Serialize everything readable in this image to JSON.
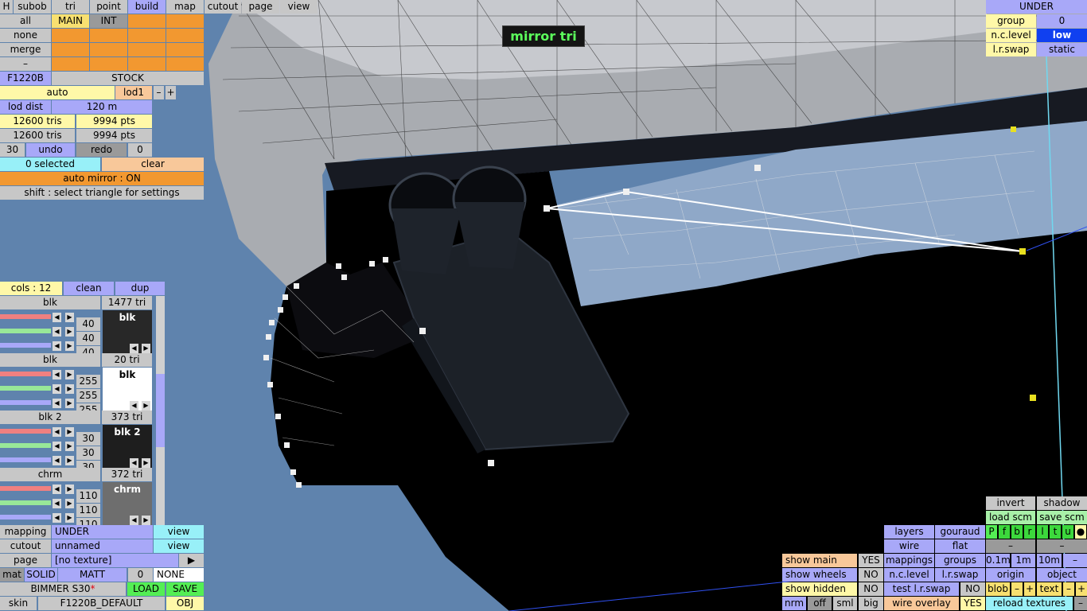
{
  "toast": "mirror tri",
  "menu": {
    "h": "H",
    "items": [
      "subob",
      "tri",
      "point",
      "build",
      "map",
      "cutout",
      "page",
      "view"
    ]
  },
  "sel": {
    "all": "all",
    "main": "MAIN",
    "int": "INT",
    "none": "none",
    "merge": "merge",
    "dash": "–"
  },
  "model": {
    "name": "F1220B",
    "stock": "STOCK",
    "auto": "auto",
    "lod": "lod1",
    "minus": "–",
    "plus": "+",
    "lod_dist_label": "lod dist",
    "lod_dist": "120 m",
    "tris1": "12600 tris",
    "pts1": "9994 pts",
    "tris2": "12600 tris",
    "pts2": "9994 pts",
    "undo_n": "30",
    "undo": "undo",
    "redo": "redo",
    "redo_n": "0"
  },
  "selection": {
    "count": "0 selected",
    "clear": "clear",
    "auto_mirror": "auto mirror : ON",
    "hint": "shift : select triangle for settings"
  },
  "colours": {
    "cols": "cols : 12",
    "clean": "clean",
    "dup": "dup",
    "items": [
      {
        "name": "blk",
        "tris": "1477 tri",
        "r": "40",
        "g": "40",
        "b": "40",
        "swatch": "blk",
        "color": "#282828",
        "text": "#ffffff"
      },
      {
        "name": "blk",
        "tris": "20 tri",
        "r": "255",
        "g": "255",
        "b": "255",
        "swatch": "blk",
        "color": "#ffffff",
        "text": "#000000"
      },
      {
        "name": "blk 2",
        "tris": "373 tri",
        "r": "30",
        "g": "30",
        "b": "30",
        "swatch": "blk 2",
        "color": "#1e1e1e",
        "text": "#ffffff"
      },
      {
        "name": "chrm",
        "tris": "372 tri",
        "r": "110",
        "g": "110",
        "b": "110",
        "swatch": "chrm",
        "color": "#6e6e6e",
        "text": "#ffffff"
      }
    ]
  },
  "mapping": {
    "label": "mapping",
    "value": "UNDER",
    "view": "view"
  },
  "cutout": {
    "label": "cutout",
    "value": "unnamed",
    "view": "view"
  },
  "page": {
    "label": "page",
    "value": "[no texture]",
    "arrow": "▶"
  },
  "mat": {
    "label": "mat",
    "solid": "SOLID",
    "matt": "MATT",
    "num": "0",
    "none": "NONE"
  },
  "car": {
    "name": "BIMMER S30",
    "star": "*",
    "load": "LOAD",
    "save": "SAVE"
  },
  "skin": {
    "label": "skin",
    "value": "F1220B_DEFAULT",
    "obj": "OBJ"
  },
  "group_panel": {
    "title": "UNDER",
    "group": "group",
    "group_val": "0",
    "nclevel": "n.c.level",
    "nclevel_val": "low",
    "lrswap": "l.r.swap",
    "lrswap_val": "static"
  },
  "view_panel": {
    "invert": "invert",
    "shadow": "shadow",
    "load_scm": "load scm",
    "save_scm": "save scm",
    "letters": [
      "P",
      "f",
      "b",
      "r",
      "l",
      "t",
      "u",
      "●"
    ],
    "layers": "layers",
    "gouraud": "gouraud",
    "wire": "wire",
    "flat": "flat",
    "mappings": "mappings",
    "groups": "groups",
    "d1": "0.1m",
    "d2": "1m",
    "d3": "10m",
    "dash": "–",
    "nclevel": "n.c.level",
    "lrswap": "l.r.swap",
    "origin": "origin",
    "object": "object",
    "test_lr": "test l.r.swap",
    "test_val": "NO",
    "blob": "blob",
    "text": "text",
    "wire_overlay": "wire overlay",
    "wire_overlay_val": "YES",
    "reload": "reload textures",
    "nrm": "nrm",
    "off": "off",
    "sml": "sml",
    "big": "big"
  },
  "show": {
    "main": "show main",
    "main_val": "YES",
    "wheels": "show wheels",
    "wheels_val": "NO",
    "hidden": "show hidden",
    "hidden_val": "NO"
  }
}
